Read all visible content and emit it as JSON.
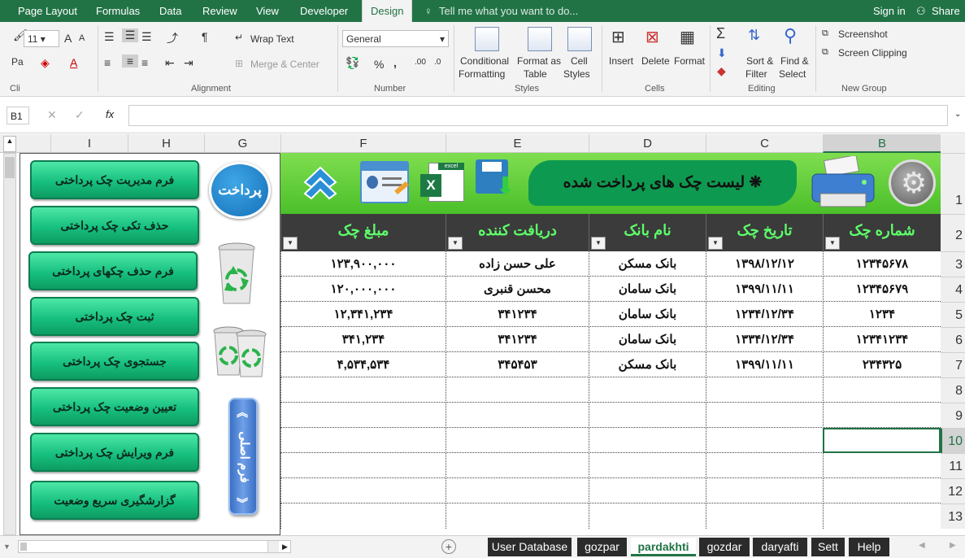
{
  "ribbon_tabs": [
    "Page Layout",
    "Formulas",
    "Data",
    "Review",
    "View",
    "Developer",
    "Design"
  ],
  "tell_me": "Tell me what you want to do...",
  "sign_in": "Sign in",
  "share": "Share",
  "font": {
    "size": "11",
    "grow": "A",
    "shrink": "A",
    "paste_label": "Pa",
    "clip_label": "Cli"
  },
  "alignment": {
    "wrap_text": "Wrap Text",
    "merge_center": "Merge & Center",
    "group_label": "Alignment"
  },
  "number": {
    "format": "General",
    "percent": "%",
    "comma": ",",
    "group_label": "Number"
  },
  "styles": {
    "conditional": "Conditional",
    "formatting": "Formatting",
    "format_as": "Format as",
    "table": "Table",
    "cell": "Cell",
    "cell_styles": "Styles",
    "group_label": "Styles"
  },
  "cells": {
    "insert": "Insert",
    "delete": "Delete",
    "format": "Format",
    "group_label": "Cells"
  },
  "editing": {
    "sort": "Sort &",
    "filter": "Filter",
    "find": "Find &",
    "select": "Select",
    "group_label": "Editing"
  },
  "newgroup": {
    "screenshot": "Screenshot",
    "screen_clipping": "Screen Clipping",
    "group_label": "New Group"
  },
  "formula_bar": {
    "name_box": "B1",
    "fx": "fx",
    "value": ""
  },
  "columns": [
    "I",
    "H",
    "G",
    "F",
    "E",
    "D",
    "C",
    "B"
  ],
  "rows": [
    "1",
    "2",
    "3",
    "4",
    "5",
    "6",
    "7",
    "8",
    "9",
    "10",
    "11",
    "12",
    "13"
  ],
  "selected_row": "10",
  "selected_col": "B",
  "left_buttons": [
    "فرم مدیریت چک پرداختی",
    "حذف تکی چک پرداختی",
    "فرم حذف چکهای پرداختی",
    "ثبت چک پرداختی",
    "جستجوی چک پرداختی",
    "تعیین وضعیت چک پرداختی",
    "فرم ویرایش چک پرداختی",
    "گزارشگیری سریع  وضعیت"
  ],
  "sticker_text": "پرداخت",
  "main_form_text": "فرم اصلی",
  "banner_title": "❋ لیست چک های پرداخت شده",
  "excel_label": "excel",
  "table_headers": [
    "مبلغ چک",
    "دریافت کننده",
    "نام بانک",
    "تاریخ چک",
    "شماره چک"
  ],
  "table_rows": [
    [
      "۱۲۳,۹۰۰,۰۰۰",
      "علی حسن زاده",
      "بانک مسکن",
      "۱۳۹۸/۱۲/۱۲",
      "۱۲۳۴۵۶۷۸"
    ],
    [
      "۱۲۰,۰۰۰,۰۰۰",
      "محسن قنبری",
      "بانک سامان",
      "۱۳۹۹/۱۱/۱۱",
      "۱۲۳۴۵۶۷۹"
    ],
    [
      "۱۲,۳۴۱,۲۳۴",
      "۳۴۱۲۳۴",
      "بانک سامان",
      "۱۲۳۴/۱۲/۳۴",
      "۱۲۳۴"
    ],
    [
      "۳۴۱,۲۳۴",
      "۳۴۱۲۳۴",
      "بانک سامان",
      "۱۳۳۴/۱۲/۳۴",
      "۱۲۳۴۱۲۳۴"
    ],
    [
      "۴,۵۳۴,۵۳۴",
      "۳۴۵۴۵۳",
      "بانک مسکن",
      "۱۳۹۹/۱۱/۱۱",
      "۲۳۴۳۲۵"
    ]
  ],
  "sheet_tabs": [
    "User Database",
    "gozpar",
    "pardakhti",
    "gozdar",
    "daryafti",
    "Sett",
    "Help"
  ],
  "active_sheet": "pardakhti",
  "colors": {
    "excel_green": "#217346",
    "button_green": "#17c07f",
    "header_text": "#5dff6a",
    "banner": "#4bbf2a"
  }
}
